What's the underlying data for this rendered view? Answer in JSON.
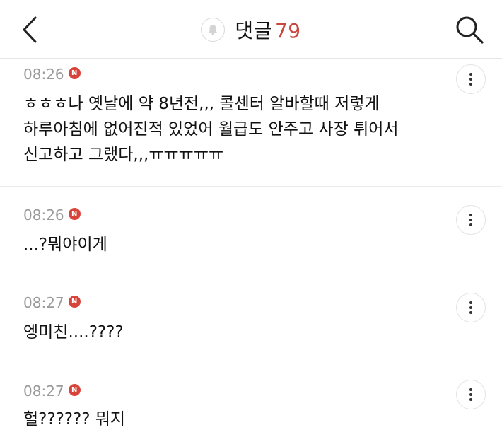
{
  "header": {
    "title": "댓글",
    "count": "79",
    "accent_color": "#c8463d",
    "icons": {
      "back": "chevron-left-icon",
      "notification": "bell-icon",
      "search": "search-icon"
    }
  },
  "comments": [
    {
      "time": "08:26",
      "badge": "N",
      "lines": [
        "ㅎㅎㅎ나 옛날에 약 8년전,,, 콜센터 알바할때 저렇게",
        "하루아침에 없어진적 있었어 월급도 안주고 사장 튀어서",
        "신고하고 그랬다,,,ㅠㅠㅠㅠㅠ"
      ]
    },
    {
      "time": "08:26",
      "badge": "N",
      "lines": [
        "...?뭐야이게"
      ]
    },
    {
      "time": "08:27",
      "badge": "N",
      "lines": [
        "엥미친....????"
      ]
    },
    {
      "time": "08:27",
      "badge": "N",
      "lines": [
        "헐?????? 뭐지"
      ]
    }
  ]
}
